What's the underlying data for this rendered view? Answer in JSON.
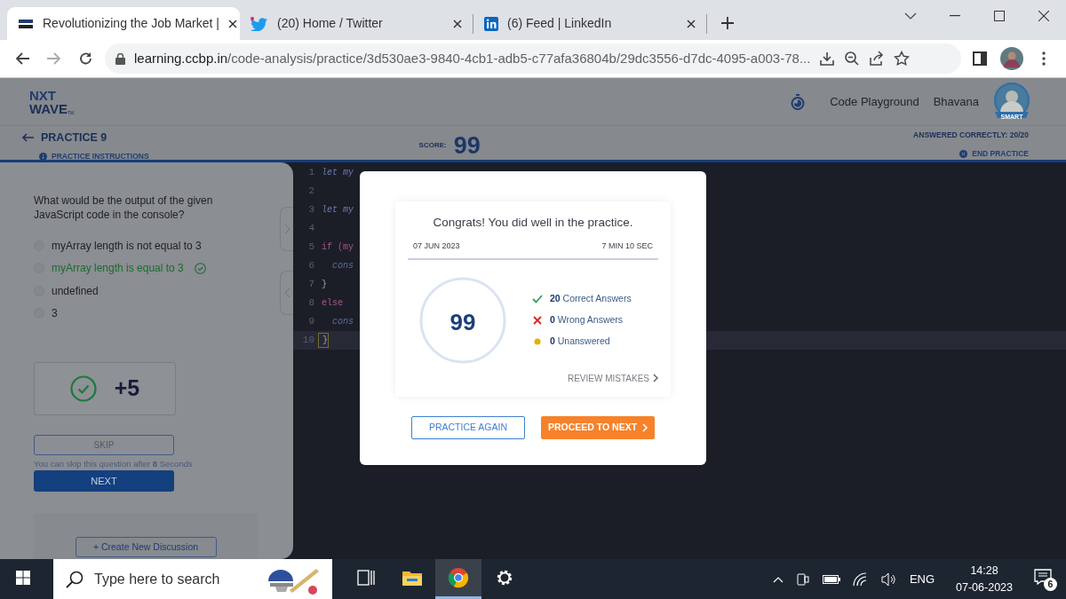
{
  "browser": {
    "tabs": [
      {
        "title": "Revolutionizing the Job Market |",
        "selected": true
      },
      {
        "title": "(20) Home / Twitter",
        "selected": false
      },
      {
        "title": "(6) Feed | LinkedIn",
        "selected": false
      }
    ],
    "url_host": "learning.ccbp.in",
    "url_path": "/code-analysis/practice/3d530ae3-9840-4cb1-adb5-c77afa36804b/29dc3556-d7dc-4095-a003-78..."
  },
  "header": {
    "logo_top": "NXT",
    "logo_bottom": "WAVE",
    "logo_mark": "TM",
    "nav": [
      "Code Playground",
      "Bhavana"
    ],
    "badge": "SMART"
  },
  "subheader": {
    "title": "PRACTICE 9",
    "instructions": "PRACTICE INSTRUCTIONS",
    "score_label": "SCORE:",
    "score": "99",
    "answered": "ANSWERED CORRECTLY: 20/20",
    "end": "END PRACTICE"
  },
  "question": {
    "text": "What would be the output of the given JavaScript code in the console?",
    "options": [
      {
        "label": "myArray length is not equal to 3",
        "selected": false,
        "correct": false
      },
      {
        "label": "myArray length is equal to 3",
        "selected": false,
        "correct": true
      },
      {
        "label": "undefined",
        "selected": false,
        "correct": false
      },
      {
        "label": "3",
        "selected": false,
        "correct": false
      }
    ],
    "result": "+5",
    "skip": "SKIP",
    "skip_note": "You can skip this question after **8** Seconds",
    "next": "NEXT",
    "discussion": "+ Create New Discussion"
  },
  "editor": {
    "lines": [
      {
        "number": "1",
        "code": "let my",
        "kind": "keyword"
      },
      {
        "number": "2",
        "kind": "plain"
      },
      {
        "number": "3",
        "code": "let my",
        "kind": "keyword"
      },
      {
        "number": "4",
        "kind": "plain"
      },
      {
        "number": "5",
        "code": "if (my",
        "kind": "control"
      },
      {
        "number": "6",
        "code": "  cons",
        "kind": "call"
      },
      {
        "number": "7",
        "code": "}",
        "kind": "plain"
      },
      {
        "number": "8",
        "code": "else",
        "kind": "control"
      },
      {
        "number": "9",
        "code": "  cons",
        "kind": "call"
      },
      {
        "number": "10",
        "code": "}",
        "kind": "active"
      }
    ]
  },
  "modal": {
    "title": "Congrats! You did well in the practice.",
    "date": "07 JUN 2023",
    "duration": "7 MIN 10 SEC",
    "score": "99",
    "stats": [
      {
        "kind": "correct",
        "count": "20",
        "label": "Correct Answers"
      },
      {
        "kind": "wrong",
        "count": "0",
        "label": "Wrong Answers"
      },
      {
        "kind": "unanswered",
        "count": "0",
        "label": "Unanswered"
      }
    ],
    "review": "REVIEW MISTAKES",
    "buttons": [
      "PRACTICE AGAIN",
      "PROCEED TO NEXT"
    ]
  },
  "taskbar": {
    "search_placeholder": "Type here to search",
    "apps": [
      {
        "kind": "taskview",
        "selected": false
      },
      {
        "kind": "explorer",
        "selected": false
      },
      {
        "kind": "chrome",
        "selected": true
      },
      {
        "kind": "settings",
        "selected": false
      }
    ],
    "language": "ENG",
    "time": "14:28",
    "date": "07-06-2023",
    "notifications": "6"
  }
}
